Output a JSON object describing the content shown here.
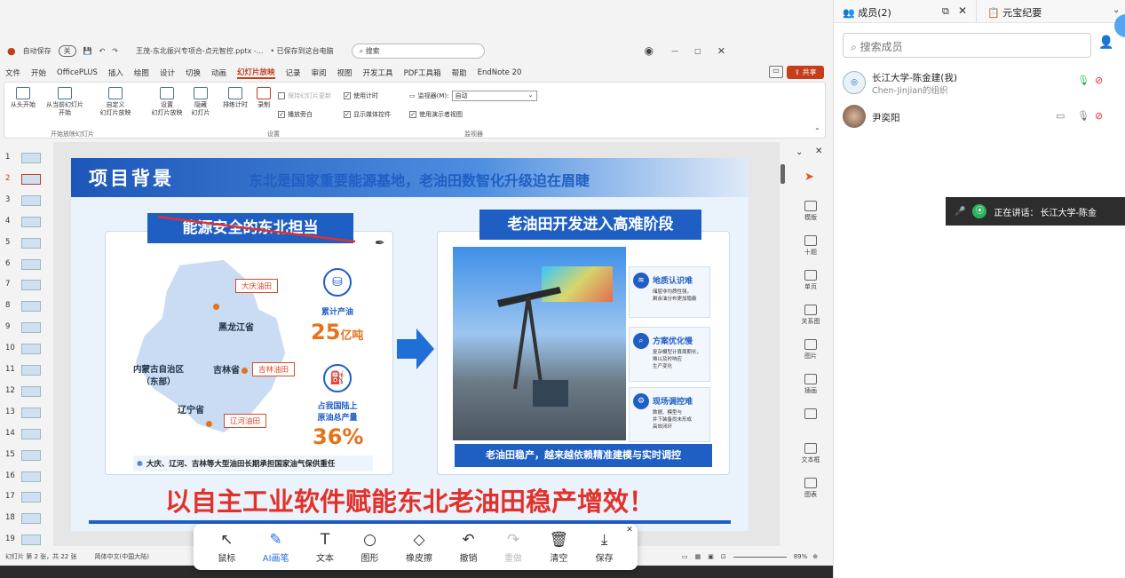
{
  "titlebar": {
    "autosave": "自动保存",
    "autosave_state": "关",
    "filename": "王茂-东北振兴专项合-点元智控.pptx -...",
    "saved": "• 已保存到这台电脑",
    "search_placeholder": "搜索"
  },
  "menu": [
    "文件",
    "开始",
    "OfficePLUS",
    "插入",
    "绘图",
    "设计",
    "切换",
    "动画",
    "幻灯片放映",
    "记录",
    "审阅",
    "视图",
    "开发工具",
    "PDF工具箱",
    "帮助",
    "EndNote 20"
  ],
  "menu_active": "幻灯片放映",
  "share_label": "共享",
  "ribbon": {
    "from_start": "从头开始",
    "from_current": "从当前幻灯片\n开始",
    "custom": "自定义\n幻灯片放映",
    "setup": "设置\n幻灯片放映",
    "hide": "隐藏\n幻灯片",
    "rehearse": "排练计时",
    "record": "录制",
    "keep_updated": "保持幻灯片更新",
    "play_narration": "播放旁白",
    "use_timing": "使用计时",
    "show_media": "显示媒体控件",
    "monitor_label": "监视器(M):",
    "monitor_value": "自动",
    "presenter_view": "使用演示者视图",
    "group1": "开始放映幻灯片",
    "group2": "设置",
    "group3": "监视器"
  },
  "thumbs": [
    "1",
    "2",
    "3",
    "4",
    "5",
    "6",
    "7",
    "8",
    "9",
    "10",
    "11",
    "12",
    "13",
    "14",
    "15",
    "16",
    "17",
    "18",
    "19"
  ],
  "slide": {
    "title": "项目背景",
    "subtitle": "东北是国家重要能源基地，老油田数智化升级迫在眉睫",
    "left_header": "能源安全的东北担当",
    "right_header": "老油田开发进入高难阶段",
    "fields": [
      "大庆油田",
      "吉林油田",
      "辽河油田"
    ],
    "provinces": [
      "黑龙江省",
      "内蒙古自治区\n（东部）",
      "吉林省",
      "辽宁省"
    ],
    "stat1_label": "累计产油",
    "stat1_value": "25",
    "stat1_unit": "亿吨",
    "stat2_label": "占我国陆上\n原油总产量",
    "stat2_value": "36%",
    "left_footer": "大庆、辽河、吉林等大型油田长期承担国家油气保供重任",
    "cards": [
      {
        "title": "地质认识难",
        "desc": "储层非均质性强，\n剩余油分布更加隐蔽"
      },
      {
        "title": "方案优化慢",
        "desc": "复杂模型计算周期长，\n难以及时响应\n生产变化"
      },
      {
        "title": "现场调控难",
        "desc": "数据、模型与\n井下装备尚未形成\n高效闭环"
      }
    ],
    "right_footer": "老油田稳产，越来越依赖精准建模与实时调控",
    "bottom_banner": "以自主工业软件赋能东北老油田稳产增效！"
  },
  "rightpanel": [
    "模版",
    "十题",
    "单页",
    "关系图",
    "图片",
    "插画",
    "",
    "文本框",
    "图表"
  ],
  "status": {
    "slide_count": "幻灯片 第 2 张，共 22 张",
    "language": "简体中文(中国大陆)",
    "zoom": "89%"
  },
  "drawbar": [
    {
      "icon": "↖",
      "label": "鼠标"
    },
    {
      "icon": "✎",
      "label": "AI画笔"
    },
    {
      "icon": "T",
      "label": "文本"
    },
    {
      "icon": "○",
      "label": "图形"
    },
    {
      "icon": "◇",
      "label": "橡皮擦"
    },
    {
      "icon": "↶",
      "label": "撤销"
    },
    {
      "icon": "↷",
      "label": "重做"
    },
    {
      "icon": "🗑",
      "label": "清空"
    },
    {
      "icon": "⤓",
      "label": "保存"
    }
  ],
  "drawbar_active": "AI画笔",
  "members": {
    "tab_label": "成员(2)",
    "tab2_label": "元宝纪要",
    "search_placeholder": "搜索成员",
    "list": [
      {
        "name": "长江大学-陈金建(我)",
        "org": "Chen-Jinjian的组织"
      },
      {
        "name": "尹奕阳",
        "org": ""
      }
    ]
  },
  "speaking": {
    "label": "正在讲话：",
    "name": "长江大学-陈金"
  }
}
